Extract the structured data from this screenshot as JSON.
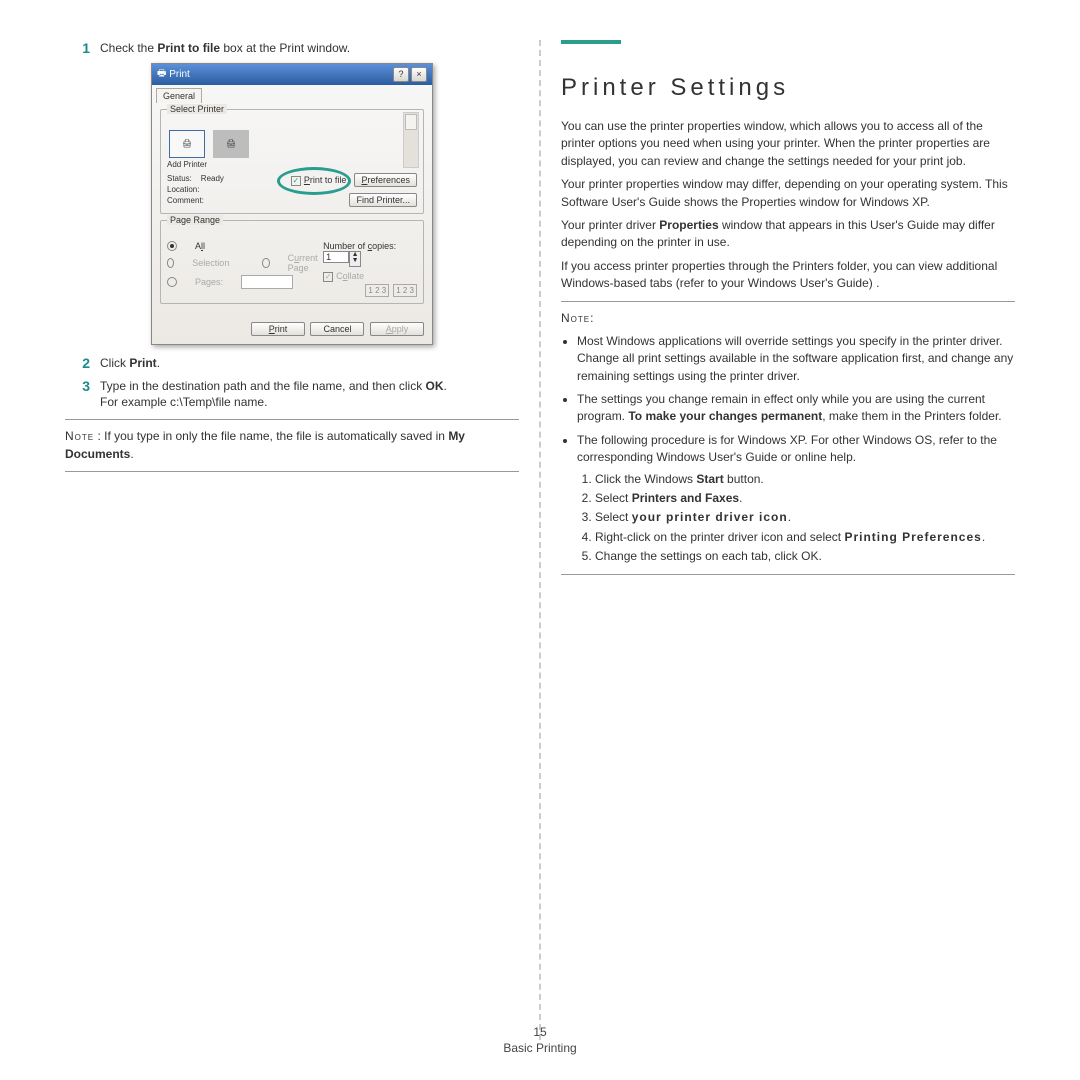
{
  "left": {
    "steps": [
      {
        "num": "1",
        "text_a": "Check the ",
        "bold_a": "Print to file",
        "text_b": " box at the Print window."
      },
      {
        "num": "2",
        "text_a": "Click ",
        "bold_a": "Print",
        "text_b": "."
      },
      {
        "num": "3",
        "text_a": "Type in the destination path and the file name, and then click ",
        "bold_a": "OK",
        "text_b": ".",
        "text_c": "For example c:\\Temp\\file name."
      }
    ],
    "note_label": "Note",
    "note_text_a": " : If you type in only the file name, the file is automatically saved in ",
    "note_bold": "My Documents",
    "note_text_b": "."
  },
  "dialog": {
    "title": "Print",
    "tab": "General",
    "group_printer": "Select Printer",
    "add_printer": "Add Printer",
    "status_lbl": "Status:",
    "status_val": "Ready",
    "location_lbl": "Location:",
    "comment_lbl": "Comment:",
    "print_to_file": "Print to file",
    "preferences": "Preferences",
    "find_printer": "Find Printer...",
    "group_range": "Page Range",
    "all": "All",
    "selection": "Selection",
    "current_page": "Current Page",
    "pages": "Pages:",
    "copies_lbl": "Number of copies:",
    "copies_val": "1",
    "collate": "Collate",
    "collate_a": "1 2 3",
    "collate_b": "1 2 3",
    "print_btn": "Print",
    "cancel_btn": "Cancel",
    "apply_btn": "Apply"
  },
  "right": {
    "heading": "Printer Settings",
    "p1": "You can use the printer properties window, which allows you to access all of the printer options you need when using your printer. When the printer properties are displayed, you can review and change the settings needed for your print job.",
    "p2": "Your printer properties window may differ, depending on your operating system. This Software User's Guide shows the Properties window for Windows XP.",
    "p3a": "Your printer driver ",
    "p3b": "Properties",
    "p3c": " window that appears in this User's Guide may differ depending on the printer in use.",
    "p4": "If you access printer properties through the Printers folder, you can view additional Windows-based tabs (refer to your Windows User's Guide) .",
    "note_label": "Note",
    "note_colon": ":",
    "b1": "Most Windows applications will override settings you specify in the printer driver. Change all print settings available in the software application first, and change any remaining settings using the printer driver.",
    "b2a": "The settings you change remain in effect only while you are using the current program. ",
    "b2b": "To make your changes permanent",
    "b2c": ", make them in the Printers folder.",
    "b3": "The following procedure is for Windows XP. For other Windows OS, refer to the corresponding Windows User's Guide or online help.",
    "s1a": "Click the Windows ",
    "s1b": "Start",
    "s1c": " button.",
    "s2a": "Select ",
    "s2b": "Printers and Faxes",
    "s2c": ".",
    "s3a": "Select ",
    "s3b": "your printer driver icon",
    "s3c": ".",
    "s4a": "Right-click on the printer driver icon and select ",
    "s4b": "Printing Preferences",
    "s4c": ".",
    "s5": "Change the settings on each tab, click OK."
  },
  "footer": {
    "page_num": "15",
    "section": "Basic Printing"
  }
}
